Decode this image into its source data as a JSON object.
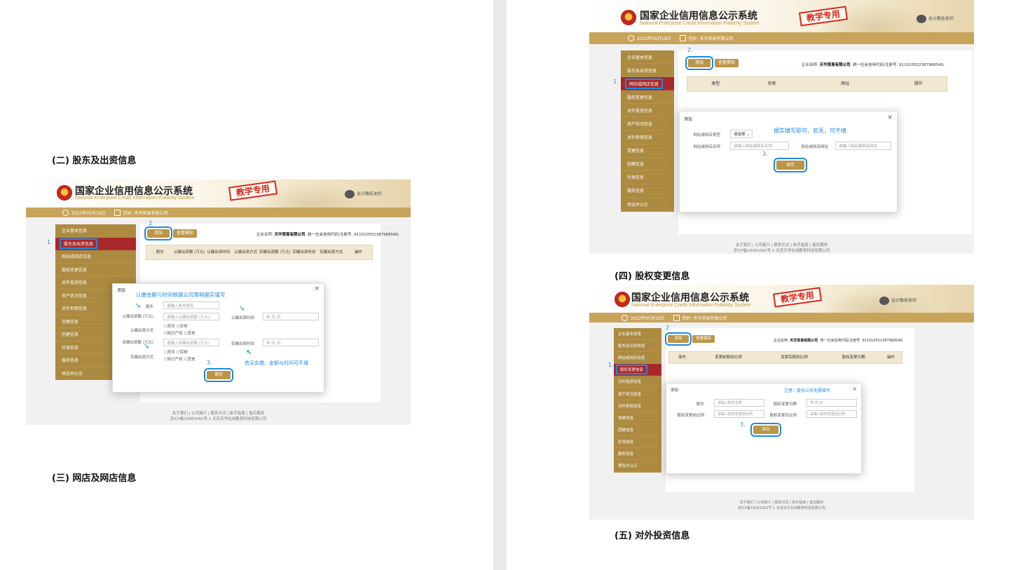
{
  "system": {
    "title_cn": "国家企业信用信息公示系统",
    "title_en": "National Enterprise Credit Information Publicity System",
    "stamp": "教学专用",
    "user": "会计教练老师",
    "date": "2022年05月19日",
    "org": "您好: 天华贸易有限公司",
    "add_btn": "添加",
    "view_btn": "查看需知",
    "company_prefix": "企业名称:",
    "company_name": "天华贸易有限公司",
    "credit_code": "统一社会信用代码/注册号: 91101055238796854G",
    "save_btn": "保存",
    "modal_title": "添加",
    "close": "×",
    "footer_line1": "关于我们 | 公司简介 | 联系方式 | 新手指南 | 售后服务",
    "footer_line2": "京ICP备16061061号-1 北京天华在线教育科技有限公司"
  },
  "nav_items": [
    "企业基本信息",
    "股东及出资信息",
    "网站或网店信息",
    "股权变更信息",
    "对外投资信息",
    "资产状况信息",
    "对外担保信息",
    "党建信息",
    "团建信息",
    "社保信息",
    "服务信息",
    "预览并公示"
  ],
  "headings": {
    "shareholder": "(二) 股东及出资信息",
    "website": "(三) 网店及网店信息",
    "equity": "(四) 股权变更信息",
    "investment": "(五) 对外投资信息"
  },
  "shot_shareholder": {
    "step1": "1",
    "step2": "2",
    "step3": "3.",
    "columns": [
      "股东",
      "认缴出资额 (万元)",
      "认缴出资时间",
      "认缴出资方式",
      "实缴出资额 (万元)",
      "实缴出资时间",
      "实缴出资方式",
      "操作"
    ],
    "note_top": "认缴金额与时间根据公司章程据实填写",
    "note_bottom": "若无实缴，金额与时间可不填",
    "f_shareholder": "股东",
    "f_shareholder_ph": "请输入股东姓名",
    "f_sub_amount": "认缴出资额 (万元)",
    "f_sub_amount_ph": "请输入认缴出资额 (万元)",
    "f_sub_time": "认缴出资时间",
    "f_date_ph": "年-月-日",
    "f_sub_method": "认缴出资方式",
    "f_paid_amount": "实缴出资额 (万元)",
    "f_paid_amount_ph": "请输入实缴出资额 (万元)",
    "f_paid_time": "实缴出资时间",
    "f_paid_method": "实缴出资方式",
    "opt_line1": "☐货币  ☐实物",
    "opt_line2": "☐知识产权  ☐其他"
  },
  "shot_website": {
    "step1": "1.",
    "step2": "2.",
    "step3": "3.",
    "columns": [
      "类型",
      "名称",
      "网址",
      "操作"
    ],
    "note": "据实填写即可，若无，可不填",
    "f_type": "网站或网店类型",
    "f_type_value": "请选择 ⌄",
    "f_name": "网站或网店名称",
    "f_name_ph": "请输入网站或网店名称",
    "f_url": "网站或网店网址",
    "f_url_ph": "请输入网站或网店网址"
  },
  "shot_equity": {
    "step1": "1.",
    "step2": "2.",
    "step3": "3.",
    "columns": [
      "股东",
      "变更前股权比例",
      "变更后股权比例",
      "股权变更日期",
      "操作"
    ],
    "note": "注意：股份公司无需填写",
    "f_holder": "股东",
    "f_holder_ph": "请输入股东名称",
    "f_date": "股权变更日期",
    "f_date_ph": "年-月-日",
    "f_before": "股权变更前比例",
    "f_before_ph": "请输入股权变更前比例",
    "f_after": "股权变更后比例",
    "f_after_ph": "请输入股权变更后比例"
  }
}
